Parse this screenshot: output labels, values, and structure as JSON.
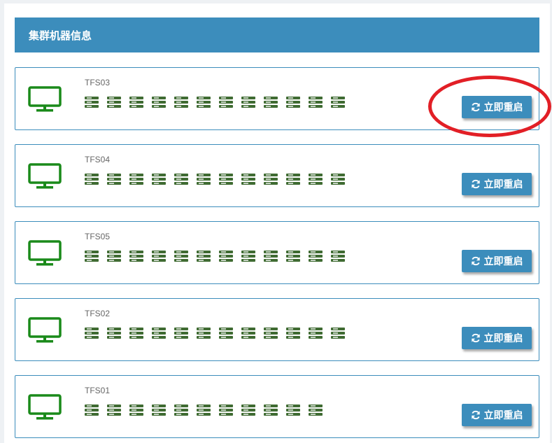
{
  "panel": {
    "title": "集群机器信息"
  },
  "machines": [
    {
      "name": "TFS03",
      "server_count": 12,
      "restart_label": "立即重启"
    },
    {
      "name": "TFS04",
      "server_count": 12,
      "restart_label": "立即重启"
    },
    {
      "name": "TFS05",
      "server_count": 12,
      "restart_label": "立即重启"
    },
    {
      "name": "TFS02",
      "server_count": 12,
      "restart_label": "立即重启"
    },
    {
      "name": "TFS01",
      "server_count": 11,
      "restart_label": "立即重启"
    }
  ],
  "icons": {
    "machine": "monitor-icon",
    "server": "server-icon",
    "restart": "refresh-icon"
  },
  "colors": {
    "header_bg": "#3c8dbc",
    "monitor_icon": "#1a8a1a",
    "server_icon": "#3f6b32",
    "highlight": "#e21f26"
  },
  "annotation": {
    "highlighted_machine": "TFS03"
  }
}
